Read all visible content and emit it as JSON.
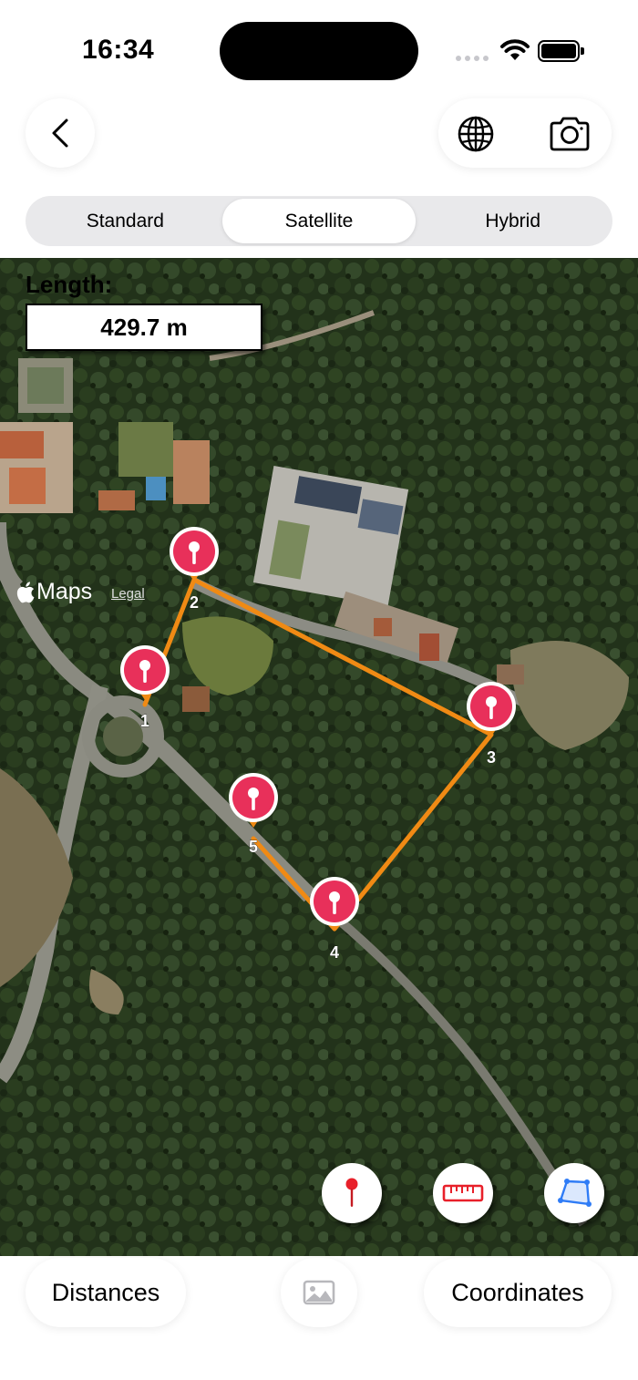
{
  "status_bar": {
    "time": "16:34"
  },
  "top_bar": {
    "back_icon": "chevron-left-icon",
    "globe_icon": "globe-icon",
    "camera_icon": "camera-icon"
  },
  "map_type": {
    "options": [
      "Standard",
      "Satellite",
      "Hybrid"
    ],
    "selected": "Satellite"
  },
  "measurement": {
    "label": "Length:",
    "value": "429.7 m"
  },
  "pins": [
    {
      "label": "1"
    },
    {
      "label": "2"
    },
    {
      "label": "3"
    },
    {
      "label": "4"
    },
    {
      "label": "5"
    }
  ],
  "map_attribution": {
    "brand": "Maps",
    "legal": "Legal"
  },
  "map_tools": [
    "pin-icon",
    "ruler-icon",
    "polygon-icon"
  ],
  "bottom_bar": {
    "distances": "Distances",
    "photo_icon": "photo-icon",
    "coordinates": "Coordinates"
  },
  "colors": {
    "route": "#f08a14",
    "pin": "#e8305a",
    "accent": "#2f7cf6"
  }
}
